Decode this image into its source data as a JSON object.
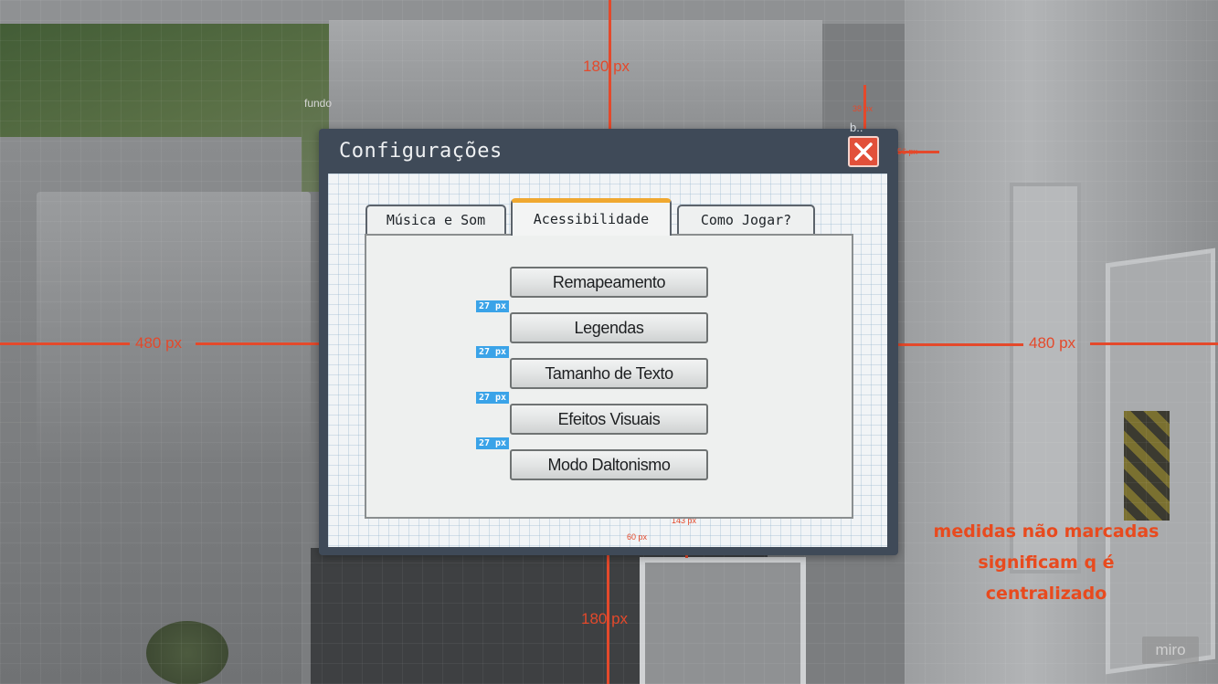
{
  "background": {
    "label": "fundo"
  },
  "dialog": {
    "title": "Configurações",
    "close_icon": "close-x-icon",
    "close_label": "b.."
  },
  "tabs": [
    {
      "label": "Música e Som",
      "active": false
    },
    {
      "label": "Acessibilidade",
      "active": true
    },
    {
      "label": "Como Jogar?",
      "active": false
    }
  ],
  "options": [
    {
      "label": "Remapeamento"
    },
    {
      "label": "Legendas"
    },
    {
      "label": "Tamanho de Texto"
    },
    {
      "label": "Efeitos Visuais"
    },
    {
      "label": "Modo Daltonismo"
    }
  ],
  "annotations": {
    "top": "180 px",
    "bottom": "180 px",
    "left": "480 px",
    "right": "480 px",
    "close_top": "38 px",
    "close_right": "56 px",
    "button_gap": "27 px",
    "bottom_gap": "60 px",
    "buttons_bottom": "143 px",
    "note": "medidas não marcadas significam q é centralizado"
  },
  "watermark": "miro",
  "colors": {
    "dialog_frame": "#3f4a58",
    "active_tab_accent": "#f0a830",
    "close_button": "#e2503a",
    "annotation": "#e4492b",
    "gap_badge": "#3aa3e8"
  }
}
